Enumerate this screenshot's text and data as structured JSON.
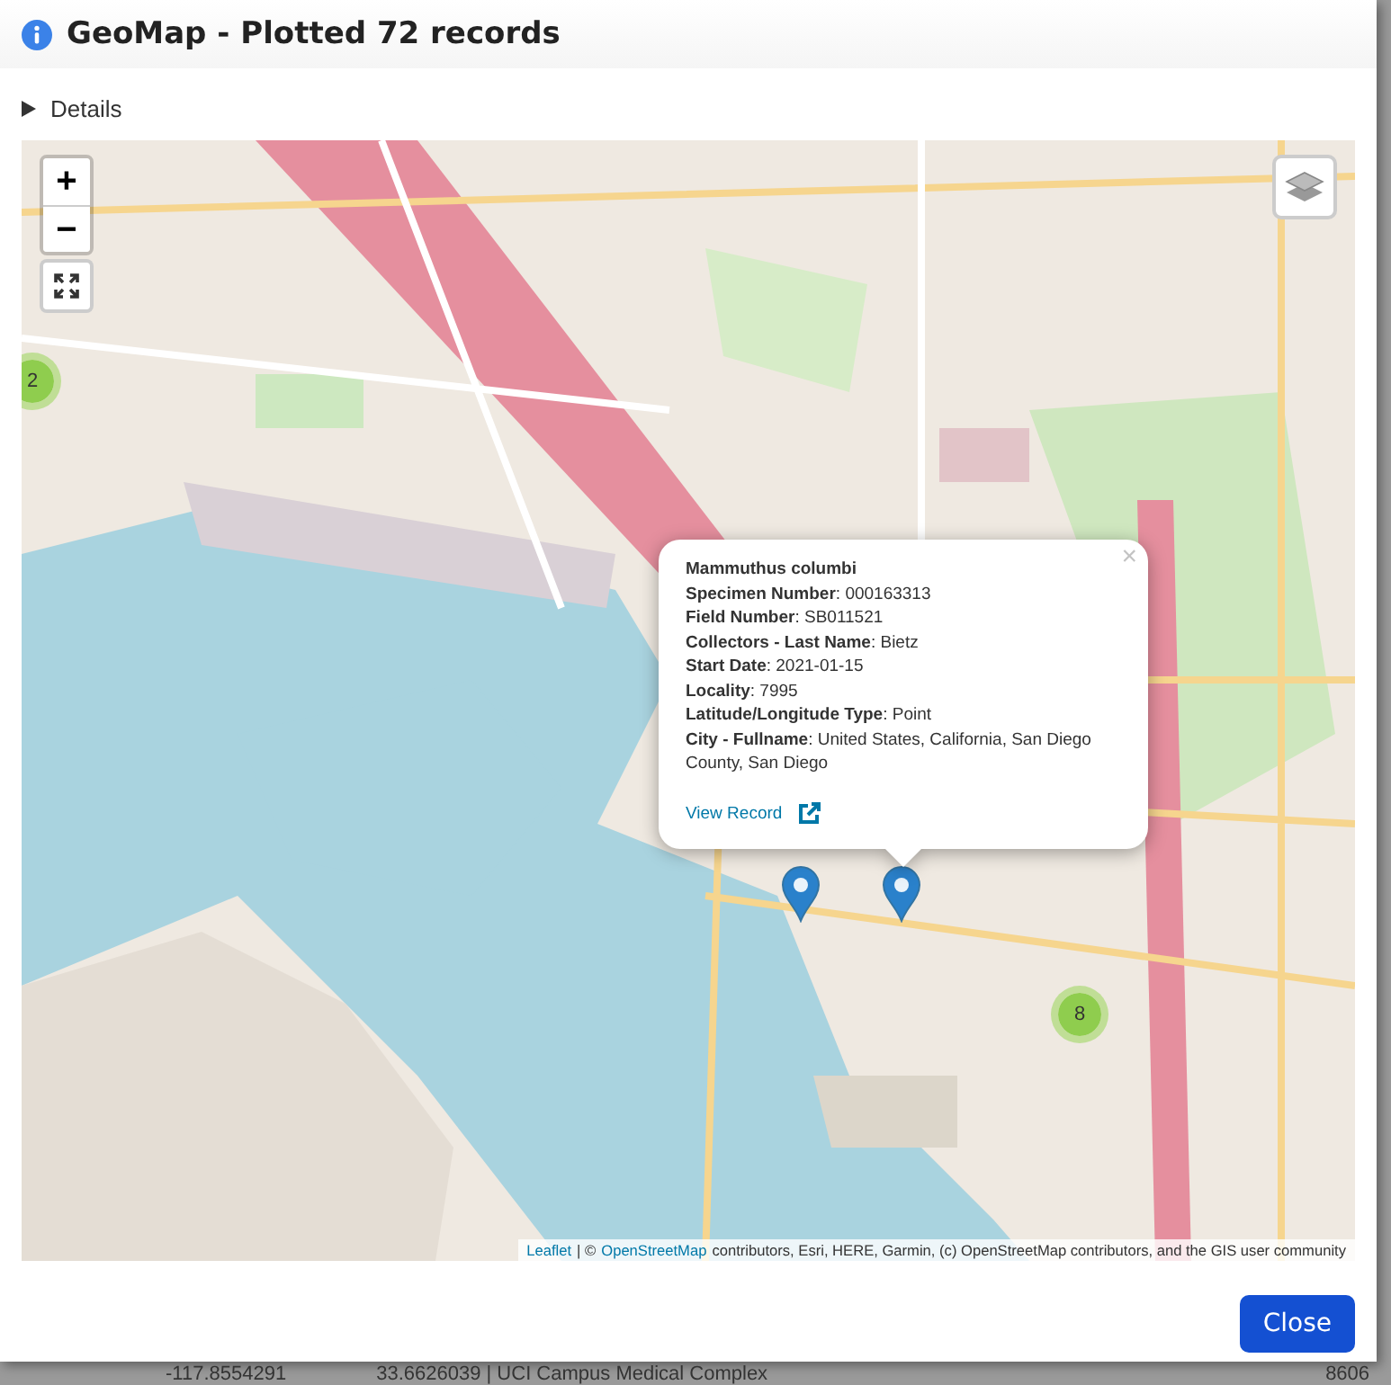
{
  "dialog": {
    "title": "GeoMap - Plotted 72 records",
    "details": {
      "label": "Details",
      "expanded": false
    },
    "map": {
      "zoom_in": "+",
      "zoom_out": "−",
      "clusters": [
        {
          "count": "2"
        },
        {
          "count": "8"
        }
      ],
      "popup": {
        "close": "×",
        "title": "Mammuthus columbi",
        "fields": [
          "**Specimen Number**: 000163313",
          "**Field Number**: SB011521",
          "**Collectors - Last Name**: Bietz",
          "**Start Date**: 2021-01-15",
          "**Locality**: 7995",
          "**Latitude/Longitude Type**: Point",
          "**City - Fullname**: United States, California, San Diego County, San Diego"
        ],
        "link": "View Record"
      },
      "attribution": {
        "leaflet": "Leaflet",
        "separator": "| ©",
        "osm": "OpenStreetMap",
        "rest": "contributors, Esri, HERE, Garmin, (c) OpenStreetMap contributors, and the GIS user community"
      }
    },
    "buttons": [
      {
        "label": "Close"
      }
    ]
  },
  "background_row": {
    "cells": [
      "-117.8554291",
      "33.6626039 | UCI Campus Medical Complex",
      "8606"
    ]
  }
}
